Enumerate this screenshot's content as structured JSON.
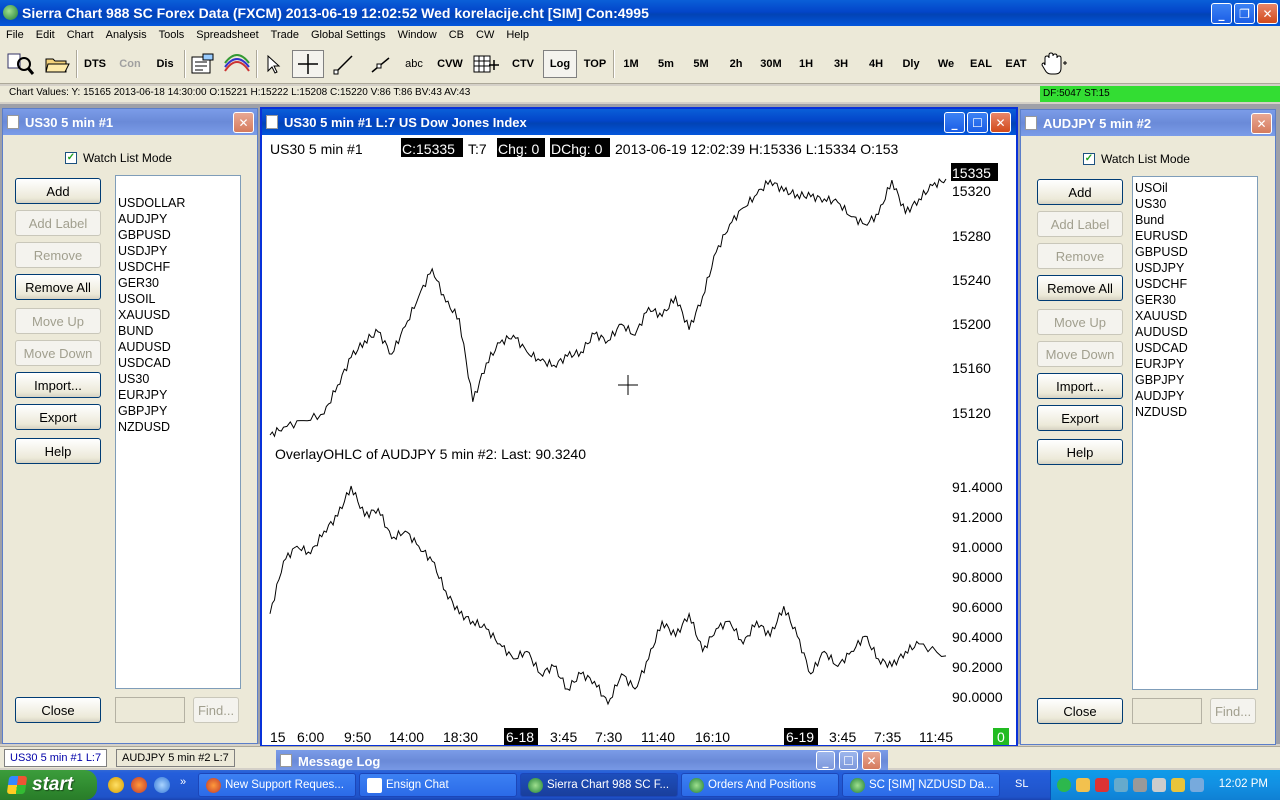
{
  "app": {
    "title": "Sierra Chart 988 SC Forex Data (FXCM) 2013-06-19  12:02:52 Wed  korelacije.cht [SIM] Con:4995"
  },
  "menu": [
    "File",
    "Edit",
    "Chart",
    "Analysis",
    "Tools",
    "Spreadsheet",
    "Trade",
    "Global Settings",
    "Window",
    "CB",
    "CW",
    "Help"
  ],
  "toolbar": {
    "dts": "DTS",
    "con": "Con",
    "dis": "Dis",
    "abc": "abc",
    "cvw": "CVW",
    "ctv": "CTV",
    "log": "Log",
    "top": "TOP",
    "tf_1m": "1M",
    "tf_5m": "5m",
    "tf_5M": "5M",
    "tf_2h": "2h",
    "tf_30m": "30M",
    "tf_1h": "1H",
    "tf_3h": "3H",
    "tf_4h": "4H",
    "tf_dly": "Dly",
    "tf_we": "We",
    "eal": "EAL",
    "eat": "EAT"
  },
  "chart_values": "Chart Values: Y: 15165 2013-06-18 14:30:00 O:15221 H:15222 L:15208 C:15220 V:86 T:86 BV:43 AV:43",
  "df_status": "DF:5047  ST:15",
  "left_panel": {
    "title": "US30  5 min   #1",
    "watch_label": "Watch List Mode",
    "buttons": {
      "add": "Add",
      "add_label": "Add Label",
      "remove": "Remove",
      "remove_all": "Remove All",
      "move_up": "Move Up",
      "move_down": "Move Down",
      "import": "Import...",
      "export": "Export",
      "help": "Help",
      "close": "Close",
      "find": "Find..."
    },
    "symbols": [
      "",
      "USDOLLAR",
      "AUDJPY",
      "GBPUSD",
      "USDJPY",
      "USDCHF",
      "GER30",
      "USOIL",
      "XAUUSD",
      "BUND",
      "AUDUSD",
      "USDCAD",
      "US30",
      "EURJPY",
      "GBPJPY",
      "NZDUSD"
    ]
  },
  "right_panel": {
    "title": "AUDJPY  5 min   #2",
    "watch_label": "Watch List Mode",
    "buttons": {
      "add": "Add",
      "add_label": "Add Label",
      "remove": "Remove",
      "remove_all": "Remove All",
      "move_up": "Move Up",
      "move_down": "Move Down",
      "import": "Import...",
      "export": "Export",
      "help": "Help",
      "close": "Close",
      "find": "Find..."
    },
    "symbols": [
      "USOil",
      "US30",
      "Bund",
      "EURUSD",
      "GBPUSD",
      "USDJPY",
      "USDCHF",
      "GER30",
      "XAUUSD",
      "AUDUSD",
      "USDCAD",
      "EURJPY",
      "GBPJPY",
      "AUDJPY",
      "NZDUSD"
    ]
  },
  "chart_window": {
    "title": "US30  5 min   #1  L:7  US Dow Jones Index",
    "header": {
      "prefix": "US30  5 min    #1",
      "close": "C:15335",
      "ticks": "T:7",
      "chg": "Chg: 0",
      "dchg": "DChg: 0",
      "rest": "2013-06-19 12:02:39 H:15336 L:15334 O:153"
    },
    "price_tag": "15335",
    "overlay_label": "OverlayOHLC of AUDJPY  5 min   #2:  Last: 90.3240",
    "y_ticks_top": [
      "15320",
      "15280",
      "15240",
      "15200",
      "15160",
      "15120"
    ],
    "y_ticks_bottom": [
      "91.4000",
      "91.2000",
      "91.0000",
      "90.8000",
      "90.6000",
      "90.4000",
      "90.2000",
      "90.0000"
    ],
    "x_ticks": [
      "15",
      "6:00",
      "9:50",
      "14:00",
      "18:30",
      "6-18",
      "3:45",
      "7:30",
      "11:40",
      "16:10",
      "6-19",
      "3:45",
      "7:35",
      "11:45"
    ],
    "corner_badge": "0"
  },
  "chart_data": [
    {
      "type": "line",
      "title": "US30  5 min  #1",
      "ylim": [
        15105,
        15345
      ],
      "x": [
        0,
        0.02,
        0.05,
        0.08,
        0.1,
        0.12,
        0.14,
        0.16,
        0.18,
        0.2,
        0.22,
        0.24,
        0.26,
        0.28,
        0.3,
        0.32,
        0.34,
        0.36,
        0.38,
        0.4,
        0.42,
        0.44,
        0.46,
        0.48,
        0.5,
        0.52,
        0.54,
        0.56,
        0.58,
        0.6,
        0.62,
        0.64,
        0.66,
        0.68,
        0.7,
        0.72,
        0.74,
        0.76,
        0.78,
        0.8,
        0.82,
        0.84,
        0.86,
        0.88,
        0.9,
        0.92,
        0.94,
        0.96,
        0.98,
        1.0
      ],
      "values": [
        15105,
        15112,
        15118,
        15124,
        15150,
        15175,
        15190,
        15198,
        15178,
        15203,
        15230,
        15255,
        15225,
        15210,
        15135,
        15170,
        15188,
        15195,
        15180,
        15172,
        15168,
        15176,
        15180,
        15196,
        15190,
        15205,
        15195,
        15220,
        15212,
        15230,
        15200,
        15230,
        15270,
        15295,
        15310,
        15322,
        15335,
        15325,
        15322,
        15320,
        15318,
        15315,
        15302,
        15295,
        15304,
        15335,
        15305,
        15318,
        15330,
        15336
      ]
    },
    {
      "type": "line",
      "title": "OverlayOHLC of AUDJPY  5 min  #2",
      "ylim": [
        89.94,
        91.55
      ],
      "x": [
        0,
        0.02,
        0.04,
        0.06,
        0.08,
        0.1,
        0.12,
        0.14,
        0.16,
        0.18,
        0.2,
        0.22,
        0.24,
        0.26,
        0.28,
        0.3,
        0.32,
        0.34,
        0.36,
        0.38,
        0.4,
        0.42,
        0.44,
        0.46,
        0.48,
        0.5,
        0.52,
        0.54,
        0.56,
        0.58,
        0.6,
        0.62,
        0.64,
        0.66,
        0.68,
        0.7,
        0.72,
        0.74,
        0.76,
        0.78,
        0.8,
        0.82,
        0.84,
        0.86,
        0.88,
        0.9,
        0.92,
        0.94,
        0.96,
        1.0
      ],
      "values": [
        90.6,
        90.95,
        91.05,
        91.0,
        91.15,
        91.25,
        91.45,
        91.25,
        91.3,
        91.1,
        91.15,
        91.05,
        90.95,
        90.75,
        90.6,
        90.55,
        90.5,
        90.4,
        90.3,
        90.35,
        90.2,
        90.25,
        90.1,
        90.2,
        90.15,
        90.0,
        90.2,
        90.1,
        90.3,
        90.55,
        90.45,
        90.6,
        90.35,
        90.5,
        90.55,
        90.4,
        90.55,
        90.45,
        90.65,
        90.45,
        90.2,
        90.35,
        90.25,
        90.35,
        90.45,
        90.3,
        90.25,
        90.35,
        90.4,
        90.32
      ]
    }
  ],
  "tabs": [
    "US30  5 min    #1  L:7",
    "AUDJPY  5 min    #2  L:7"
  ],
  "message_log": "Message Log",
  "taskbar": {
    "start": "start",
    "tasks": [
      "New Support Reques...",
      "Ensign Chat",
      "Sierra Chart 988 SC F...",
      "Orders And Positions",
      "SC [SIM] NZDUSD  Da..."
    ],
    "lang": "SL",
    "clock": "12:02 PM"
  }
}
